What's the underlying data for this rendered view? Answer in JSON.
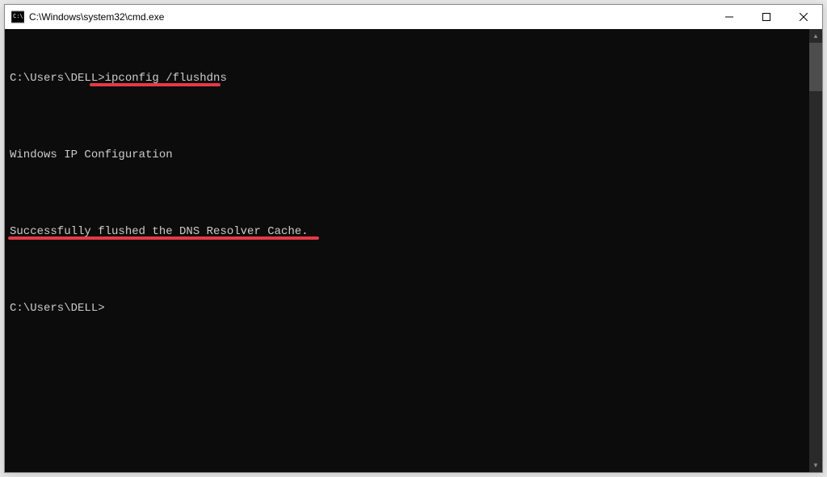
{
  "window": {
    "title": "C:\\Windows\\system32\\cmd.exe"
  },
  "terminal": {
    "lines": {
      "l0": "C:\\Users\\DELL>ipconfig /flushdns",
      "l1": "",
      "l2": "Windows IP Configuration",
      "l3": "",
      "l4": "Successfully flushed the DNS Resolver Cache.",
      "l5": "",
      "l6": "C:\\Users\\DELL>"
    }
  },
  "annotation": {
    "color": "#e63946"
  }
}
